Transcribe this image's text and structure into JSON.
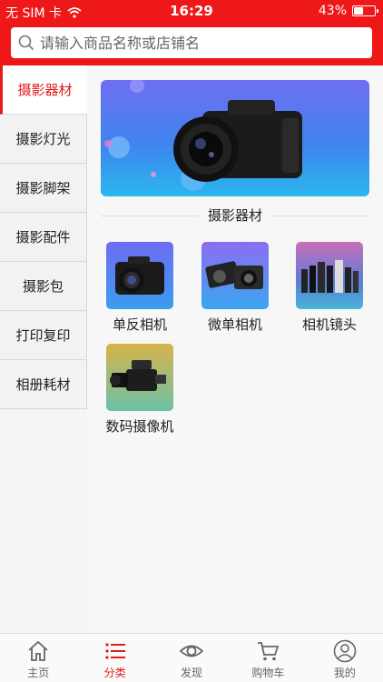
{
  "status_bar": {
    "carrier": "无 SIM 卡",
    "time": "16:29",
    "battery_text": "43%",
    "battery_level": 0.43
  },
  "search": {
    "placeholder": "请输入商品名称或店铺名"
  },
  "sidebar": {
    "items": [
      {
        "label": "摄影器材",
        "active": true
      },
      {
        "label": "摄影灯光"
      },
      {
        "label": "摄影脚架"
      },
      {
        "label": "摄影配件"
      },
      {
        "label": "摄影包"
      },
      {
        "label": "打印复印"
      },
      {
        "label": "相册耗材"
      }
    ]
  },
  "main": {
    "section_title": "摄影器材",
    "categories": [
      {
        "label": "单反相机",
        "icon": "dslr-camera-icon"
      },
      {
        "label": "微单相机",
        "icon": "mirrorless-camera-icon"
      },
      {
        "label": "相机镜头",
        "icon": "camera-lens-icon"
      },
      {
        "label": "数码摄像机",
        "icon": "video-camera-icon"
      }
    ]
  },
  "tabbar": {
    "items": [
      {
        "label": "主页",
        "icon": "home-icon"
      },
      {
        "label": "分类",
        "icon": "category-list-icon",
        "active": true
      },
      {
        "label": "发现",
        "icon": "eye-icon"
      },
      {
        "label": "购物车",
        "icon": "cart-icon"
      },
      {
        "label": "我的",
        "icon": "user-icon"
      }
    ]
  },
  "colors": {
    "accent": "#e31b1b",
    "header": "#ee1818"
  }
}
